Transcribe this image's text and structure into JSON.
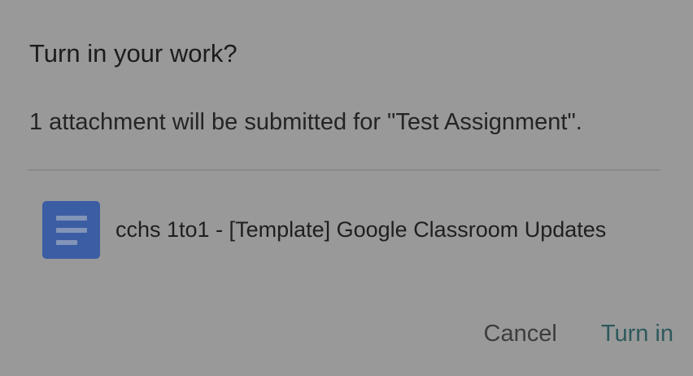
{
  "dialog": {
    "title": "Turn in your work?",
    "message": "1 attachment will be submitted for \"Test Assignment\".",
    "attachment": {
      "icon": "google-docs-icon",
      "name": "cchs 1to1 - [Template] Google Classroom Updates"
    },
    "buttons": {
      "cancel_label": "Cancel",
      "turn_in_label": "Turn in"
    }
  },
  "colors": {
    "overlay_background": "#999999",
    "doc_icon": "#3b5da3",
    "primary_action": "#2e5a5c"
  }
}
